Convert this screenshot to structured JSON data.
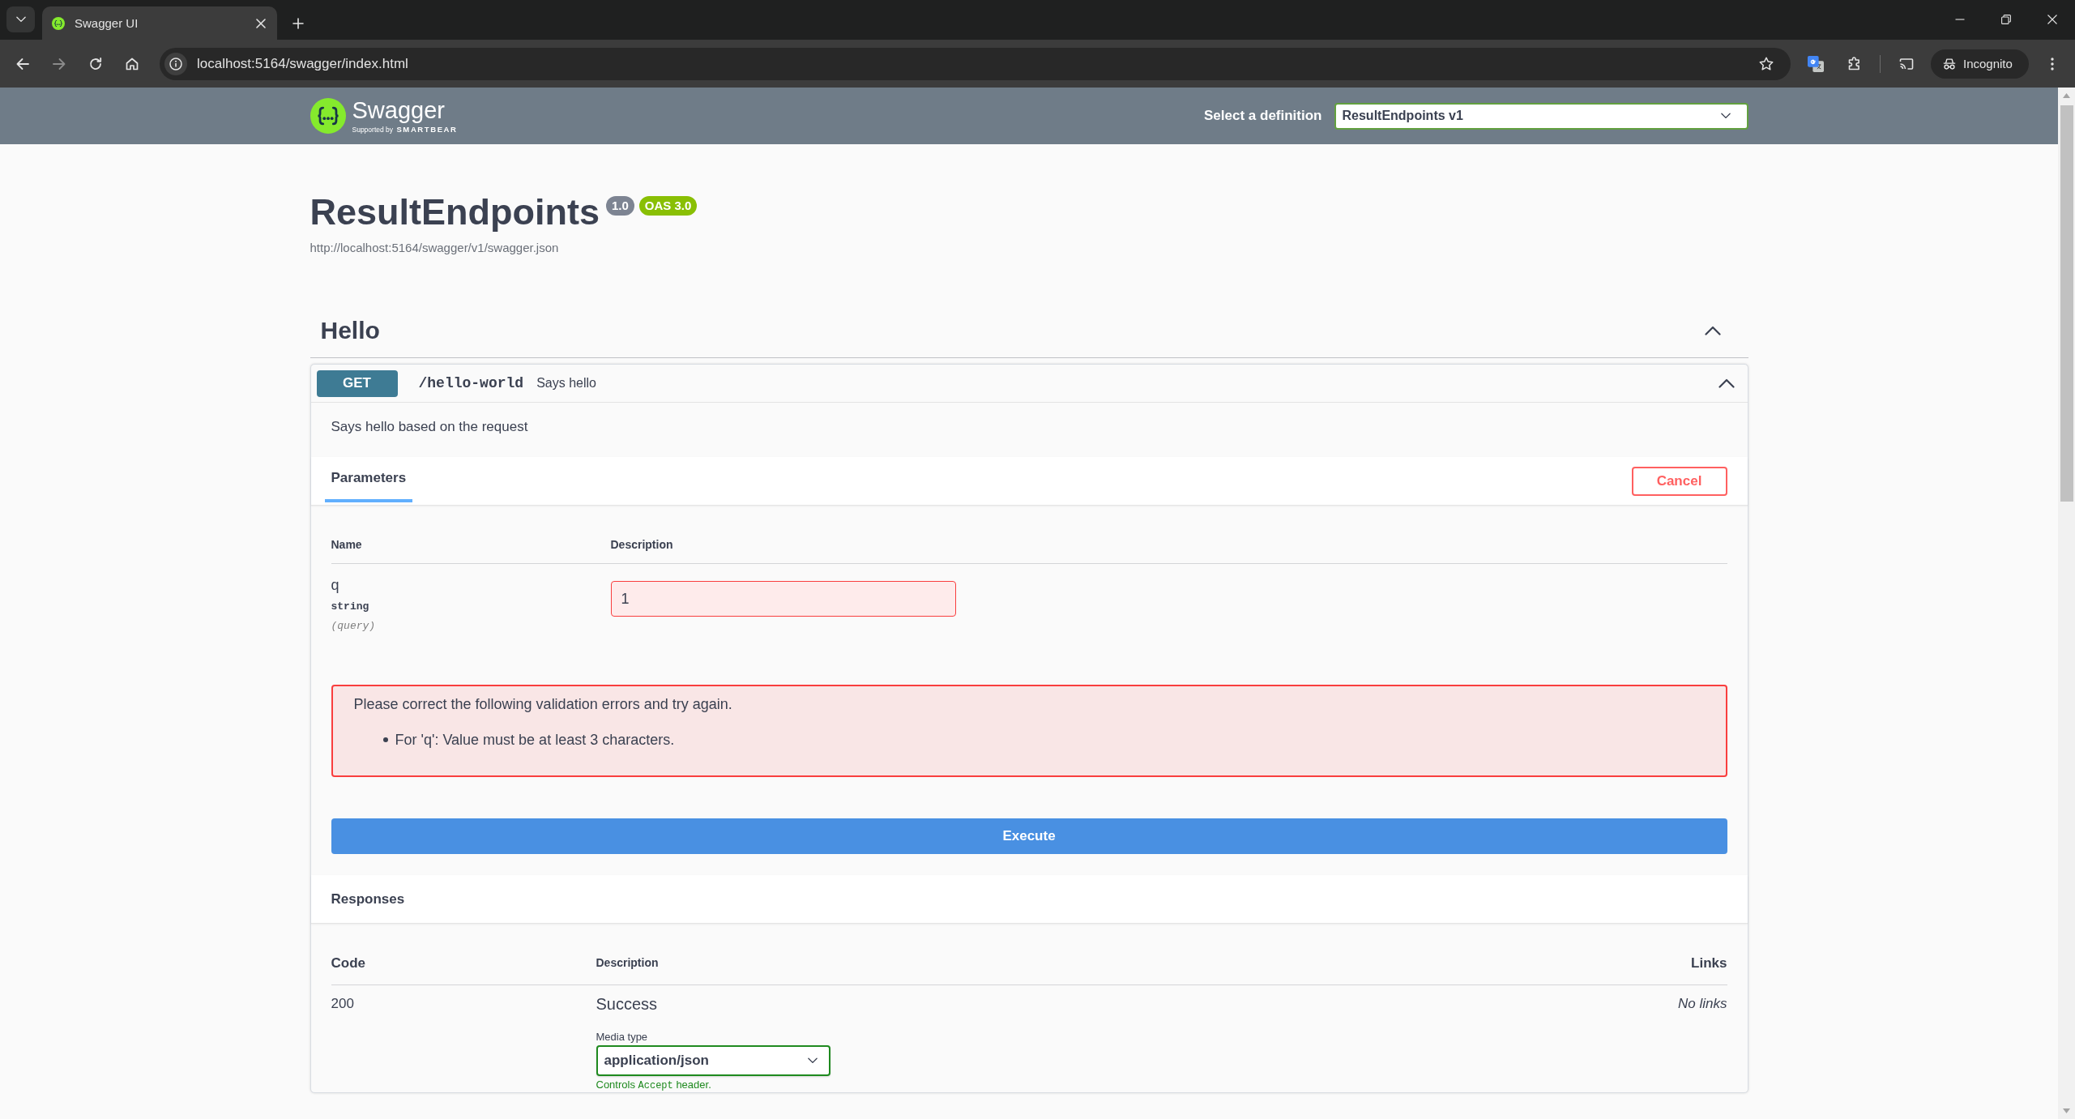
{
  "browser": {
    "tabs": [
      {
        "title": "Swagger UI",
        "selected": true
      }
    ],
    "nav": {
      "back_disabled": false,
      "forward_disabled": true
    },
    "address": "localhost:5164/swagger/index.html",
    "profile": "Incognito"
  },
  "topbar": {
    "logo": {
      "name": "Swagger",
      "tagline": "Supported by **SMARTBEAR**"
    },
    "definition_label": "Select a definition",
    "definition": "ResultEndpoints v1"
  },
  "info": {
    "title": "ResultEndpoints",
    "version": "1.0",
    "spec": "OAS 3.0",
    "url": "http://localhost:5164/swagger/v1/swagger.json"
  },
  "tags": [
    {
      "name": "Hello",
      "expanded": true,
      "operations": [
        {
          "method": "GET",
          "path": "/hello-world",
          "summary": "Says hello",
          "expanded": true,
          "description": "Says hello based on the request",
          "tabs": [
            {
              "label": "Parameters",
              "selected": true
            }
          ],
          "cancel": "Cancel",
          "parameters": {
            "columns": [
              "Name",
              "Description"
            ],
            "rows": [
              {
                "name": "q",
                "type": "string",
                "location": "(query)",
                "value": "1",
                "invalid": true
              }
            ]
          },
          "validation": {
            "message": "Please correct the following validation errors and try again.",
            "errors": [
              "For 'q': Value must be at least 3 characters."
            ]
          },
          "execute": "Execute",
          "responses": {
            "title": "Responses",
            "columns": [
              "Code",
              "Description",
              "Links"
            ],
            "rows": [
              {
                "code": "200",
                "description": "Success",
                "media_type_label": "Media type",
                "media_type": "application/json",
                "media_note": {
                  "before": "Controls",
                  "code": "Accept",
                  "after": "header."
                },
                "links": "No links"
              }
            ]
          }
        }
      ]
    }
  ]
}
